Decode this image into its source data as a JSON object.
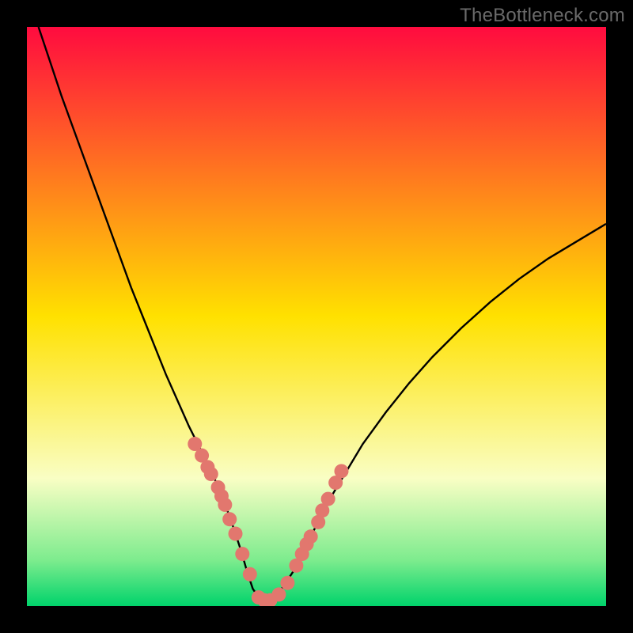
{
  "watermark": "TheBottleneck.com",
  "colors": {
    "frame": "#000000",
    "curve": "#000000",
    "markers": "#e2776e",
    "gradient_top": "#ff0b3f",
    "gradient_yellow": "#ffe100",
    "gradient_pale": "#f9fec4",
    "gradient_green_light": "#7eec8e",
    "gradient_green": "#00d36b"
  },
  "chart_data": {
    "type": "line",
    "title": "",
    "xlabel": "",
    "ylabel": "",
    "xlim": [
      0,
      100
    ],
    "ylim": [
      0,
      100
    ],
    "series": [
      {
        "name": "bottleneck-curve",
        "x": [
          2,
          4,
          6,
          8,
          10,
          12,
          14,
          16,
          18,
          20,
          22,
          24,
          26,
          28,
          30,
          32,
          33,
          34,
          35,
          36,
          37,
          38,
          39,
          40,
          41,
          42,
          43,
          44,
          46,
          48,
          50,
          52,
          55,
          58,
          62,
          66,
          70,
          75,
          80,
          85,
          90,
          95,
          100
        ],
        "y": [
          100,
          94,
          88,
          82.5,
          77,
          71.5,
          66,
          60.5,
          55,
          50,
          45,
          40,
          35.5,
          31,
          27,
          23,
          20.5,
          18,
          15.5,
          12.5,
          9.5,
          6,
          3,
          1.5,
          1,
          1,
          1.5,
          3,
          6,
          10,
          14,
          18,
          23,
          28,
          33.5,
          38.5,
          43,
          48,
          52.5,
          56.5,
          60,
          63,
          66
        ]
      }
    ],
    "markers": {
      "name": "highlight-points",
      "x": [
        29.0,
        30.2,
        31.2,
        31.8,
        33.0,
        33.6,
        34.2,
        35.0,
        36.0,
        37.2,
        38.5,
        40.0,
        41.0,
        42.0,
        43.5,
        45.0,
        46.5,
        47.5,
        48.3,
        49.0,
        50.3,
        51.0,
        52.0,
        53.3,
        54.3
      ],
      "y": [
        28.0,
        26.0,
        24.0,
        22.8,
        20.5,
        19.0,
        17.5,
        15.0,
        12.5,
        9.0,
        5.5,
        1.5,
        1.0,
        1.0,
        2.0,
        4.0,
        7.0,
        9.0,
        10.7,
        12.0,
        14.5,
        16.5,
        18.5,
        21.3,
        23.3
      ]
    }
  }
}
